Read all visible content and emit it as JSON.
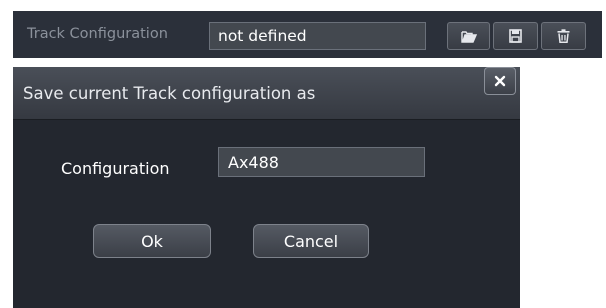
{
  "toolbar": {
    "label": "Track Configuration",
    "value": "not defined",
    "buttons": [
      {
        "icon": "folder-open-icon"
      },
      {
        "icon": "save-icon"
      },
      {
        "icon": "trash-icon"
      }
    ]
  },
  "dialog": {
    "title": "Save current Track configuration as",
    "close_label": "×",
    "field_label": "Configuration",
    "field_value": "Ax488",
    "ok_label": "Ok",
    "cancel_label": "Cancel"
  }
}
